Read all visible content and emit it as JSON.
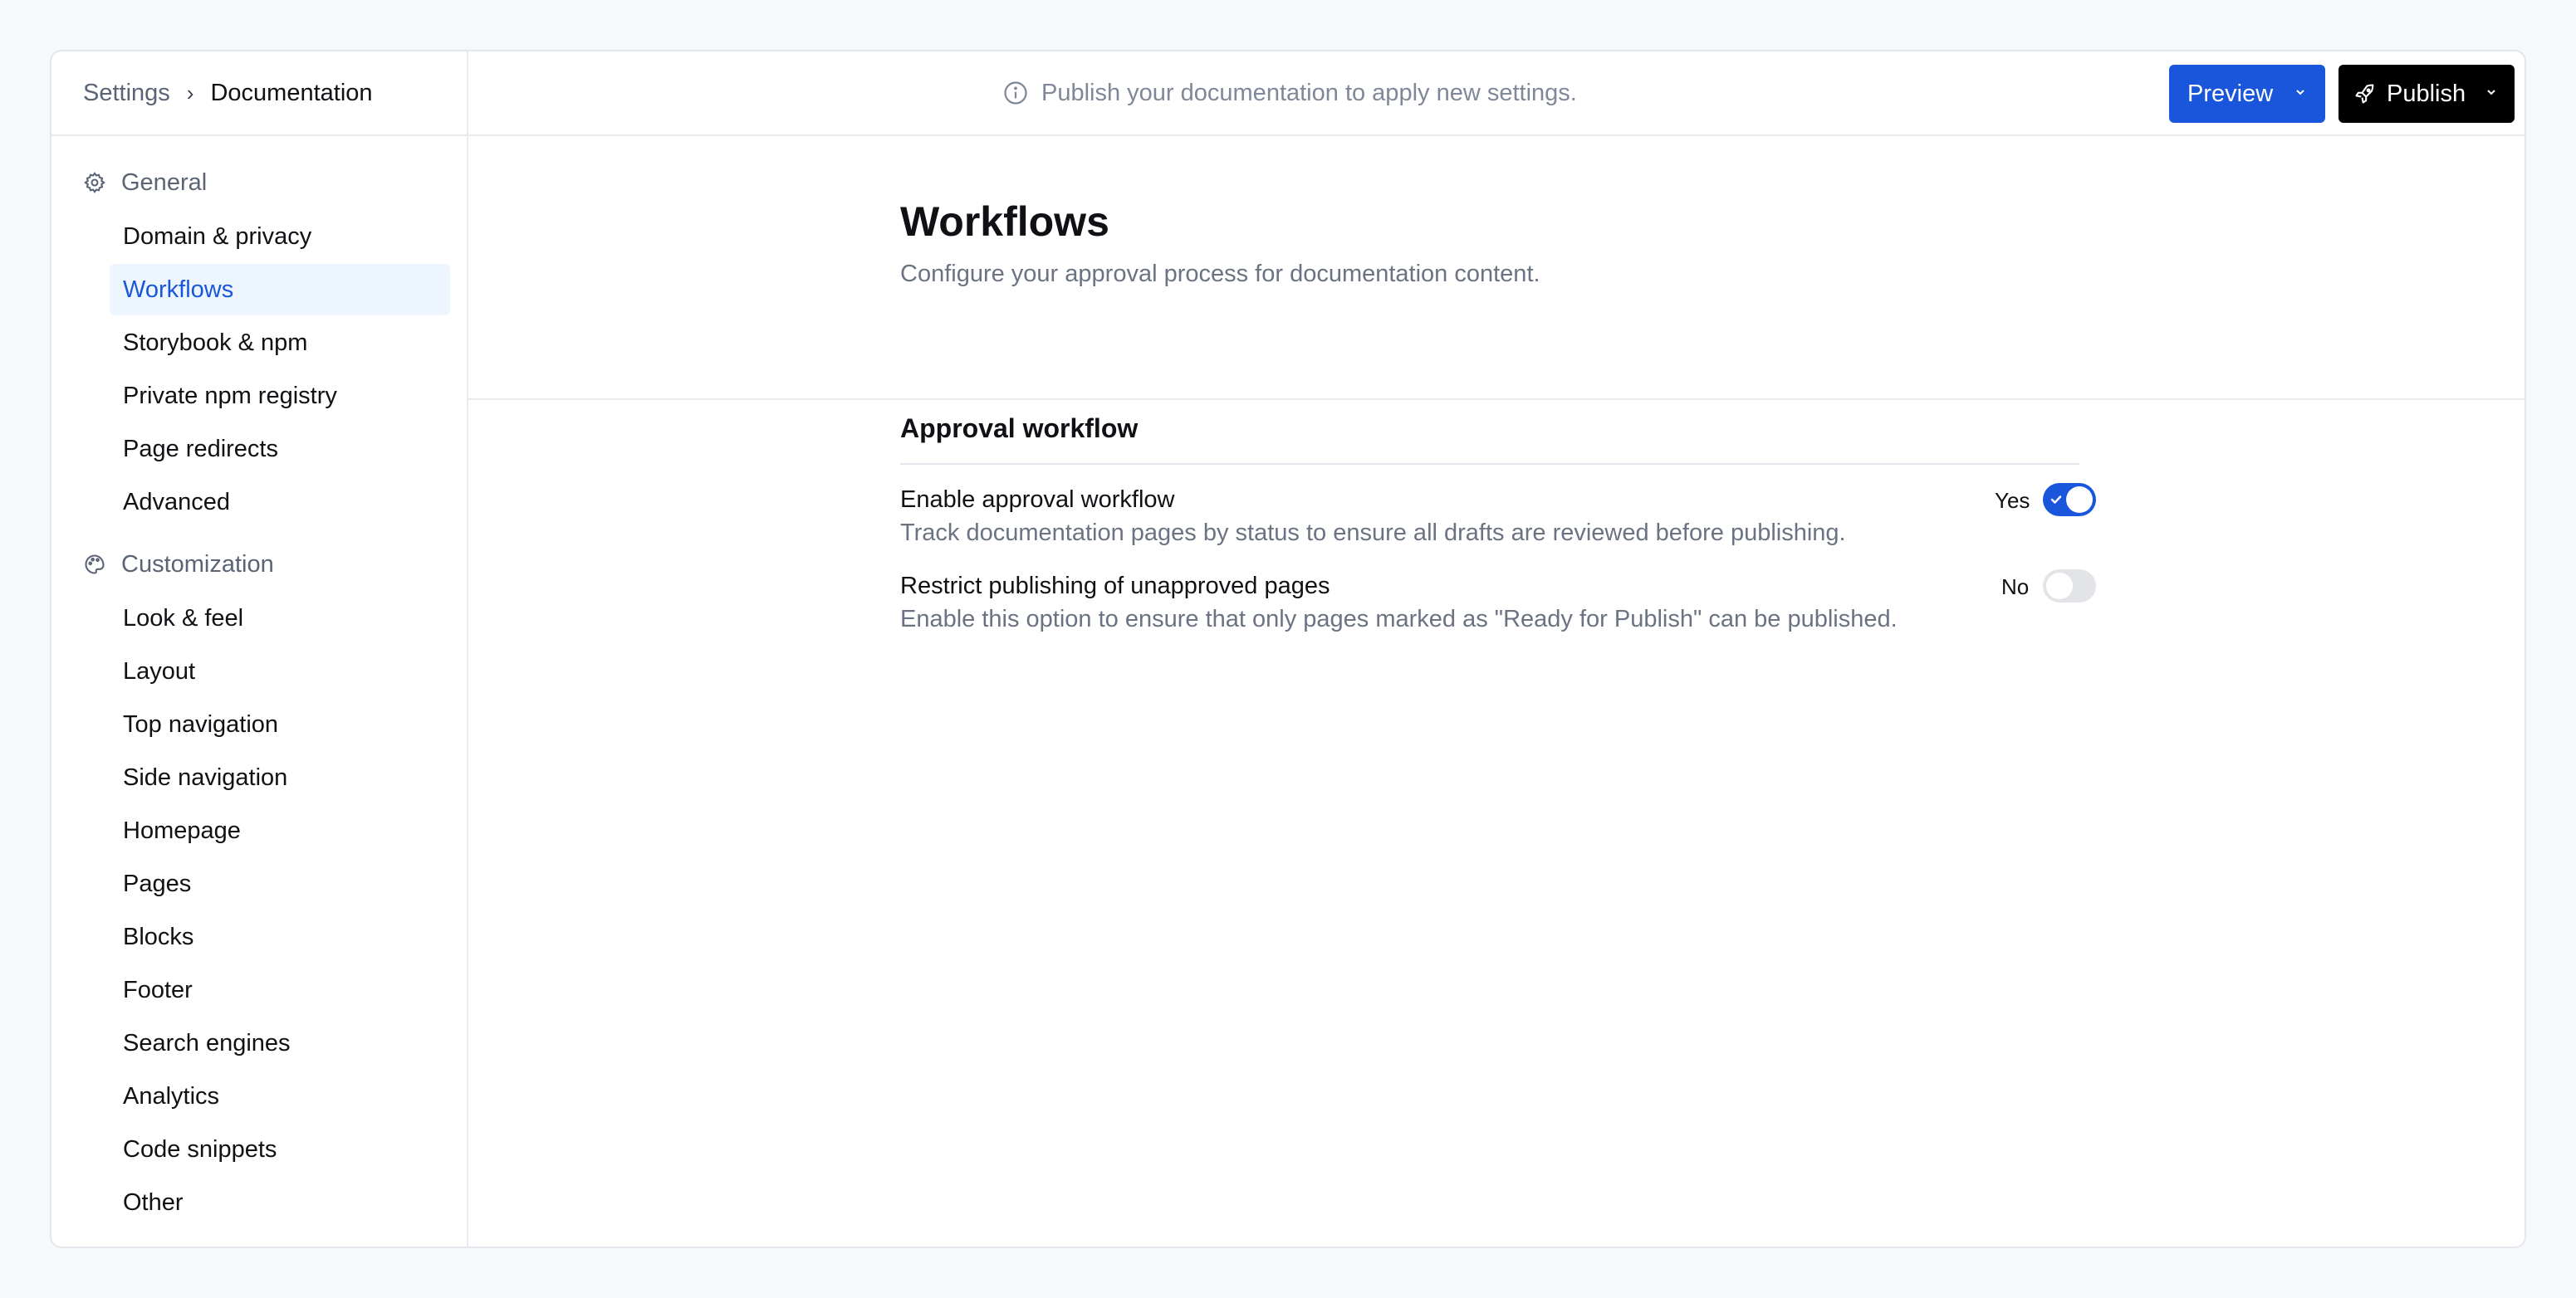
{
  "breadcrumb": {
    "parent": "Settings",
    "separator": "›",
    "current": "Documentation"
  },
  "notice": {
    "text": "Publish your documentation to apply new settings.",
    "icon": "info-icon"
  },
  "actions": {
    "preview_label": "Preview",
    "publish_label": "Publish"
  },
  "colors": {
    "accent": "#1a56db",
    "publish_bg": "#000000",
    "active_bg": "#edf6fe"
  },
  "sidebar": {
    "groups": [
      {
        "label": "General",
        "icon": "gear-icon",
        "items": [
          "Domain & privacy",
          "Workflows",
          "Storybook & npm",
          "Private npm registry",
          "Page redirects",
          "Advanced"
        ]
      },
      {
        "label": "Customization",
        "icon": "palette-icon",
        "items": [
          "Look & feel",
          "Layout",
          "Top navigation",
          "Side navigation",
          "Homepage",
          "Pages",
          "Blocks",
          "Footer",
          "Search engines",
          "Analytics",
          "Code snippets",
          "Other"
        ]
      }
    ],
    "active_item": "Workflows"
  },
  "main": {
    "title": "Workflows",
    "subtitle": "Configure your approval process for documentation content.",
    "section": {
      "title": "Approval workflow",
      "settings": [
        {
          "label": "Enable approval workflow",
          "description": "Track documentation pages by status to ensure all drafts are reviewed before publishing.",
          "state_label": "Yes",
          "enabled": true
        },
        {
          "label": "Restrict publishing of unapproved pages",
          "description": "Enable this option to ensure that only pages marked as \"Ready for Publish\" can be published.",
          "state_label": "No",
          "enabled": false
        }
      ]
    }
  }
}
